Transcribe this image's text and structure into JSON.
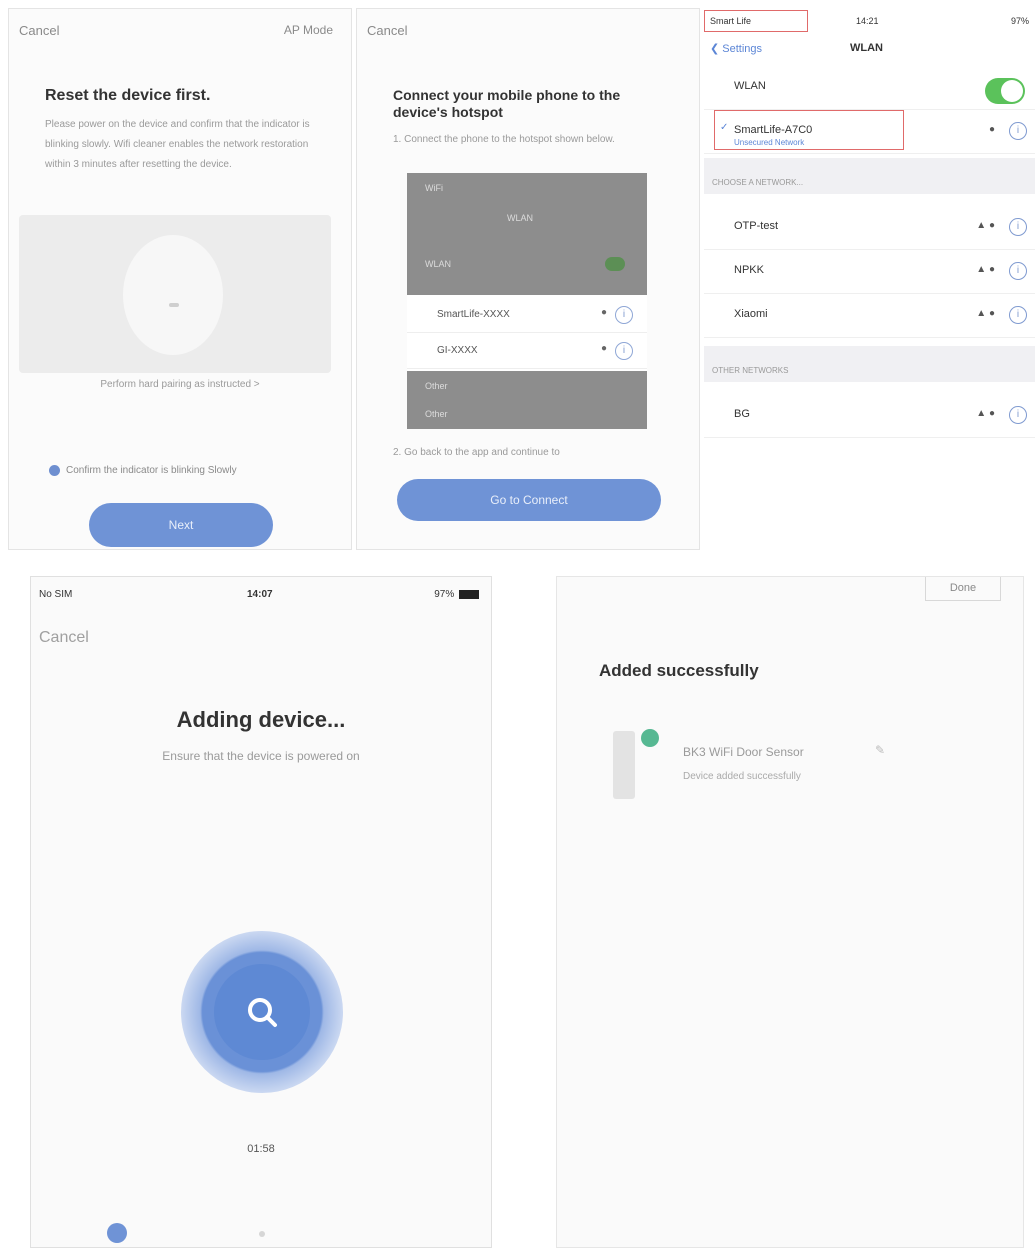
{
  "panel1": {
    "cancel": "Cancel",
    "topright": "AP Mode",
    "title": "Reset the device first.",
    "desc": "Please power on the device and confirm that the indicator is blinking slowly. Wifi cleaner enables the network restoration within 3 minutes after resetting the device.",
    "help": "Perform hard pairing as instructed >",
    "confirm": "Confirm the indicator is blinking Slowly",
    "next": "Next"
  },
  "panel2": {
    "cancel": "Cancel",
    "title": "Connect your mobile phone to the device's hotspot",
    "step1": "1. Connect the phone to the hotspot shown below.",
    "screenshot": {
      "top_left": "WiFi",
      "top_center": "WLAN",
      "wlan_label": "WLAN",
      "row1": "SmartLife-XXXX",
      "row2": "GI-XXXX",
      "bottom1": "Other",
      "bottom2": "Other"
    },
    "step2": "2. Go back to the app and continue to",
    "button": "Go to Connect"
  },
  "panel3": {
    "carrier": "Smart Life",
    "time": "14:21",
    "battery": "97%",
    "back": "Settings",
    "title": "WLAN",
    "wlan_label": "WLAN",
    "connected_name": "SmartLife-A7C0",
    "connected_sub": "Unsecured Network",
    "section_choose": "CHOOSE A NETWORK...",
    "networks": [
      "OTP-test",
      "NPKK",
      "Xiaomi"
    ],
    "section_other": "OTHER NETWORKS",
    "other_networks": [
      "BG"
    ]
  },
  "panel4": {
    "carrier": "No SIM",
    "time": "14:07",
    "battery": "97%",
    "cancel": "Cancel",
    "title": "Adding device...",
    "subtitle": "Ensure that the device is powered on",
    "timer": "01:58"
  },
  "panel5": {
    "done": "Done",
    "title": "Added successfully",
    "device_name": "BK3 WiFi Door Sensor",
    "device_status": "Device added successfully"
  },
  "colors": {
    "accent": "#6f93d6",
    "ios_toggle": "#5bc25b",
    "highlight": "#e06a6a",
    "online_dot": "#56b892"
  }
}
